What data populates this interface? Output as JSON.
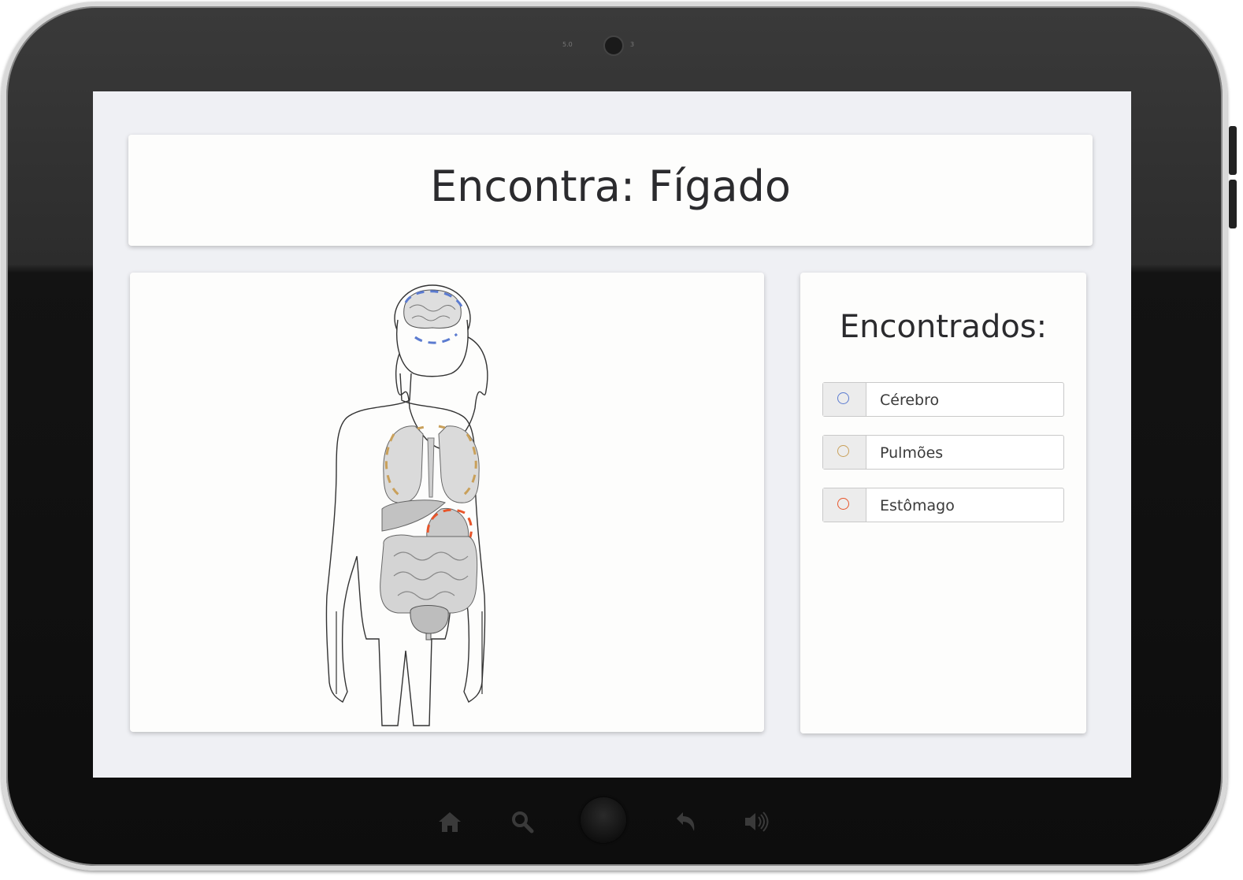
{
  "header": {
    "title": "Encontra: Fígado"
  },
  "found_panel": {
    "title": "Encontrados:",
    "items": [
      {
        "label": "Cérebro",
        "color": "#5b7bd0"
      },
      {
        "label": "Pulmões",
        "color": "#c9a05a"
      },
      {
        "label": "Estômago",
        "color": "#e8552a"
      }
    ]
  },
  "device": {
    "camera_left": "5.0",
    "camera_right": "3",
    "nav_icons": [
      "home-icon",
      "search-icon",
      "home-button",
      "back-icon",
      "volume-icon"
    ]
  }
}
